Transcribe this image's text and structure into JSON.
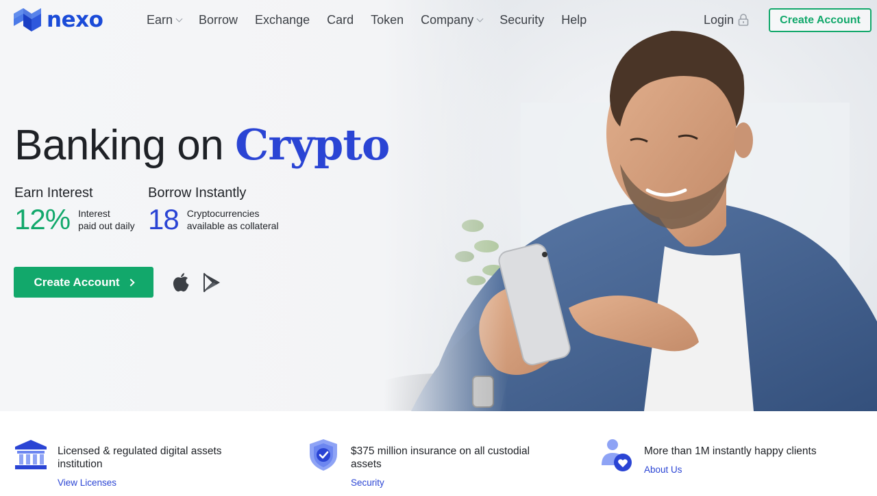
{
  "header": {
    "logo_text": "nexo",
    "nav": [
      {
        "label": "Earn",
        "has_dropdown": true
      },
      {
        "label": "Borrow",
        "has_dropdown": false
      },
      {
        "label": "Exchange",
        "has_dropdown": false
      },
      {
        "label": "Card",
        "has_dropdown": false
      },
      {
        "label": "Token",
        "has_dropdown": false
      },
      {
        "label": "Company",
        "has_dropdown": true
      },
      {
        "label": "Security",
        "has_dropdown": false
      },
      {
        "label": "Help",
        "has_dropdown": false
      }
    ],
    "login_label": "Login",
    "login_icon": "lock-icon",
    "create_account_label": "Create Account"
  },
  "hero": {
    "title_plain": "Banking on ",
    "title_accent": "Crypto",
    "stats": [
      {
        "heading": "Earn Interest",
        "value": "12%",
        "desc_line1": "Interest",
        "desc_line2": "paid out daily",
        "color": "#12a86b"
      },
      {
        "heading": "Borrow Instantly",
        "value": "18",
        "desc_line1": "Cryptocurrencies",
        "desc_line2": "available as collateral",
        "color": "#2a44d4"
      }
    ],
    "cta_label": "Create Account",
    "store_icons": [
      "apple-icon",
      "google-play-icon"
    ]
  },
  "features": [
    {
      "icon": "bank-icon",
      "text": "Licensed & regulated digital assets institution",
      "link": "View Licenses"
    },
    {
      "icon": "shield-check-icon",
      "text": "$375 million insurance on all custodial assets",
      "link": "Security"
    },
    {
      "icon": "user-heart-icon",
      "text": "More than 1M instantly happy clients",
      "link": "About Us"
    }
  ],
  "colors": {
    "brand_blue": "#1a4bd8",
    "accent_blue": "#2a44d4",
    "green": "#12a86b",
    "text": "#1e2126"
  }
}
